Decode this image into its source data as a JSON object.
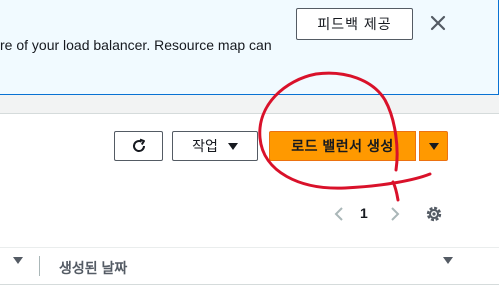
{
  "banner": {
    "text": "re of your load balancer. Resource map can",
    "feedback_label": "피드백 제공",
    "close_icon": "close-icon"
  },
  "toolbar": {
    "refresh_icon": "refresh-icon",
    "actions_label": "작업",
    "create_label": "로드 밸런서 생성",
    "accent_color": "#ff9900"
  },
  "pagination": {
    "current_page": "1"
  },
  "table": {
    "columns": [
      "생성된 날짜"
    ]
  },
  "annotation": {
    "color": "#d9112a",
    "shape": "hand-drawn circle around create button"
  }
}
